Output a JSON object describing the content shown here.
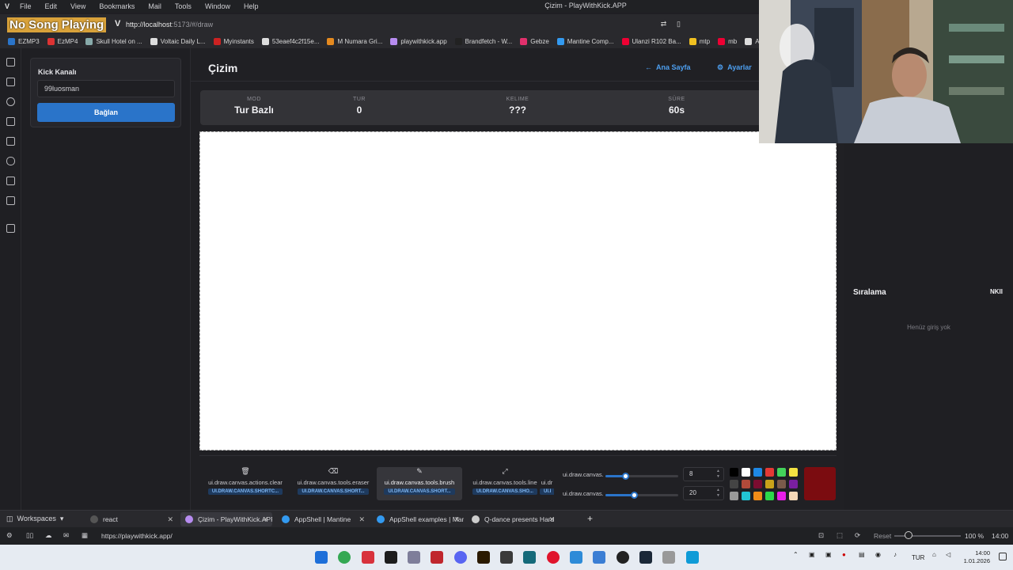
{
  "menubar": {
    "items": [
      "File",
      "Edit",
      "View",
      "Bookmarks",
      "Mail",
      "Tools",
      "Window",
      "Help"
    ],
    "window_title": "Çizim - PlayWithKick.APP"
  },
  "overlay": {
    "now_playing": "No Song Playing"
  },
  "address": {
    "url_host": "http://localhost",
    "url_rest": ":5173/#/draw"
  },
  "bookmarks": [
    {
      "label": "EZMP3",
      "color": "#2a74c9"
    },
    {
      "label": "EzMP4",
      "color": "#d33"
    },
    {
      "label": "Skull Hotel on ...",
      "color": "#8aa"
    },
    {
      "label": "Voltaic Daily L...",
      "color": "#ddd"
    },
    {
      "label": "Myinstants",
      "color": "#c22"
    },
    {
      "label": "53eaef4c2f15e...",
      "color": "#ddd"
    },
    {
      "label": "M Numara Gri...",
      "color": "#e58a1f"
    },
    {
      "label": "playwithkick.app",
      "color": "#b78cf0"
    },
    {
      "label": "Brandfetch - W...",
      "color": "#222"
    },
    {
      "label": "Gebze",
      "color": "#e1306c"
    },
    {
      "label": "Mantine Comp...",
      "color": "#339af0"
    },
    {
      "label": "Ulanzi R102 Ba...",
      "color": "#e03"
    },
    {
      "label": "mtp",
      "color": "#f0c020"
    },
    {
      "label": "mb",
      "color": "#e03"
    },
    {
      "label": "Arşiv",
      "color": "#ddd"
    }
  ],
  "kick": {
    "title": "Kick Kanalı",
    "channel_value": "99luosman",
    "connect_label": "Bağlan"
  },
  "page": {
    "title": "Çizim",
    "home_link": "Ana Sayfa",
    "settings_link": "Ayarlar"
  },
  "stats": [
    {
      "label": "MOD",
      "value": "Tur Bazlı"
    },
    {
      "label": "TUR",
      "value": "0"
    },
    {
      "label": "KELIME",
      "value": "???"
    },
    {
      "label": "SÜRE",
      "value": "60s"
    }
  ],
  "tools": [
    {
      "icon": "trash-icon",
      "glyph": "🗑",
      "label": "ui.draw.canvas.actions.clear",
      "badge": "UI.DRAW.CANVAS.SHORTC..."
    },
    {
      "icon": "eraser-icon",
      "glyph": "⌫",
      "label": "ui.draw.canvas.tools.eraser",
      "badge": "UI.DRAW.CANVAS.SHORT..."
    },
    {
      "icon": "brush-icon",
      "glyph": "✎",
      "label": "ui.draw.canvas.tools.brush",
      "badge": "UI.DRAW.CANVAS.SHORT...",
      "active": true
    },
    {
      "icon": "line-icon",
      "glyph": "⤢",
      "label": "ui.draw.canvas.tools.line",
      "badge": "UI.DRAW.CANVAS.SHO..."
    },
    {
      "icon": "more-icon",
      "glyph": "",
      "label": "ui.dr",
      "badge": "UI.I"
    }
  ],
  "sliders": [
    {
      "label": "ui.draw.canvas.",
      "value": "8",
      "level": 0.28
    },
    {
      "label": "ui.draw.canvas.",
      "value": "20",
      "level": 0.4
    }
  ],
  "palette": [
    "#000000",
    "#ffffff",
    "#1e88e5",
    "#e53935",
    "#43d35a",
    "#f4e342",
    "#444444",
    "#b24a3a",
    "#7b0c30",
    "#c9a21a",
    "#7a5a4a",
    "#7a1fa0",
    "#999999",
    "#22c4d4",
    "#f08c18",
    "#2cd84a",
    "#e81ee8",
    "#f7d9b8"
  ],
  "current_color": "#7b0c10",
  "ranking": {
    "title": "Sıralama",
    "tag": "NKII",
    "empty": "Henüz giriş yok"
  },
  "tabbar": {
    "workspaces": "Workspaces",
    "tabs": [
      {
        "label": "react",
        "color": "#555"
      },
      {
        "label": "Çizim - PlayWithKick.APP",
        "color": "#b78cf0",
        "active": true
      },
      {
        "label": "AppShell | Mantine",
        "color": "#339af0"
      },
      {
        "label": "AppShell examples | Mantine",
        "color": "#339af0"
      },
      {
        "label": "Q-dance presents Hard",
        "color": "#ccc"
      }
    ]
  },
  "status": {
    "url": "https://playwithkick.app/",
    "reset": "Reset",
    "zoom": "100 %",
    "time": "14:00"
  },
  "taskbar": {
    "lang": "TUR",
    "clock_time": "14:00",
    "clock_date": "1.01.2026"
  }
}
